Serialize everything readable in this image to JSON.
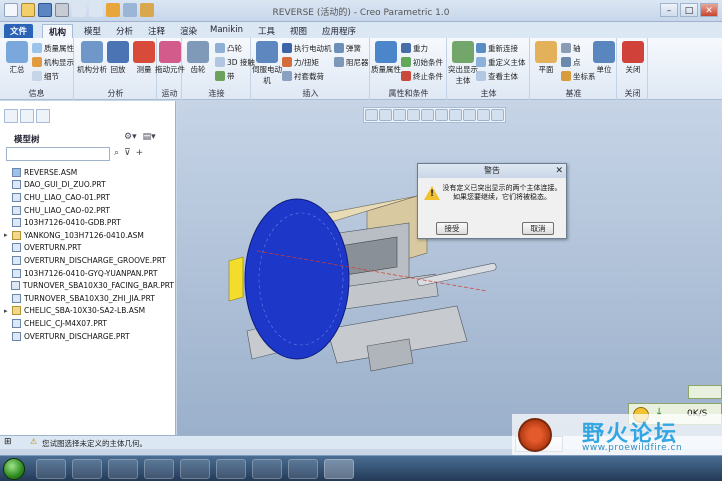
{
  "window": {
    "title": "REVERSE (活动的) - Creo Parametric 1.0"
  },
  "tabs": [
    {
      "label": "文件"
    },
    {
      "label": "机构"
    },
    {
      "label": "模型"
    },
    {
      "label": "分析"
    },
    {
      "label": "注释"
    },
    {
      "label": "渲染"
    },
    {
      "label": "Manikin"
    },
    {
      "label": "工具"
    },
    {
      "label": "视图"
    },
    {
      "label": "应用程序"
    }
  ],
  "ribbon": {
    "info": {
      "label": "信息",
      "summary": "汇总",
      "mass_props": "质量属性",
      "mech_display": "机构显示",
      "detail": "细节"
    },
    "analysis": {
      "label": "分析",
      "mech_analysis": "机构分析",
      "playback": "回放",
      "measure": "测量"
    },
    "motion": {
      "label": "运动",
      "drag": "拖动元件"
    },
    "connect": {
      "label": "连接",
      "gear": "齿轮",
      "cam": "凸轮",
      "connect3d": "3D 接触",
      "belt": "带"
    },
    "insert": {
      "label": "插入",
      "servo": "伺服电动机",
      "exec_motor": "执行电动机",
      "spring": "弹簧",
      "force": "力/扭矩",
      "damper": "阻尼器",
      "bushing": "衬套载荷"
    },
    "props": {
      "label": "属性和条件",
      "mass": "质量属性",
      "gravity": "重力",
      "initial": "初始条件",
      "terminate": "终止条件"
    },
    "body": {
      "label": "主体",
      "highlight": "突出显示主体",
      "reconnect": "重新连接",
      "redefine": "重定义主体",
      "view": "查看主体"
    },
    "datum": {
      "label": "基准",
      "plane": "平面",
      "axis": "轴",
      "point": "点",
      "csys": "坐标系"
    },
    "close": {
      "label": "关闭",
      "unit": "单位",
      "close": "关闭"
    }
  },
  "model_tree": {
    "title": "模型树",
    "items": [
      {
        "name": "REVERSE.ASM",
        "type": "root"
      },
      {
        "name": "DAO_GUI_DI_ZUO.PRT",
        "type": "part"
      },
      {
        "name": "CHU_LIAO_CAO-01.PRT",
        "type": "part"
      },
      {
        "name": "CHU_LIAO_CAO-02.PRT",
        "type": "part"
      },
      {
        "name": "103H7126-0410-GDB.PRT",
        "type": "part"
      },
      {
        "name": "YANKONG_103H7126-0410.ASM",
        "type": "asm"
      },
      {
        "name": "OVERTURN.PRT",
        "type": "part"
      },
      {
        "name": "OVERTURN_DISCHARGE_GROOVE.PRT",
        "type": "part"
      },
      {
        "name": "103H7126-0410-GYQ-YUANPAN.PRT",
        "type": "part"
      },
      {
        "name": "TURNOVER_SBA10X30_FACING_BAR.PRT",
        "type": "part"
      },
      {
        "name": "TURNOVER_SBA10X30_ZHI_JIA.PRT",
        "type": "part"
      },
      {
        "name": "CHELIC_SBA-10X30-SA2-LB.ASM",
        "type": "asm"
      },
      {
        "name": "CHELIC_CJ-M4X07.PRT",
        "type": "part"
      },
      {
        "name": "OVERTURN_DISCHARGE.PRT",
        "type": "part"
      }
    ]
  },
  "dialog": {
    "title": "警告",
    "message": "没有定义已突出显示的两个主体连接。如果您要继续，它们将被稳态。",
    "accept": "接受",
    "cancel": "取消"
  },
  "status": {
    "message": "您试图选择未定义的主体几何。",
    "select": "选"
  },
  "widget": {
    "ok": "0K/S"
  },
  "watermark": {
    "title": "野火论坛",
    "url": "www.proewildfire.cn"
  }
}
